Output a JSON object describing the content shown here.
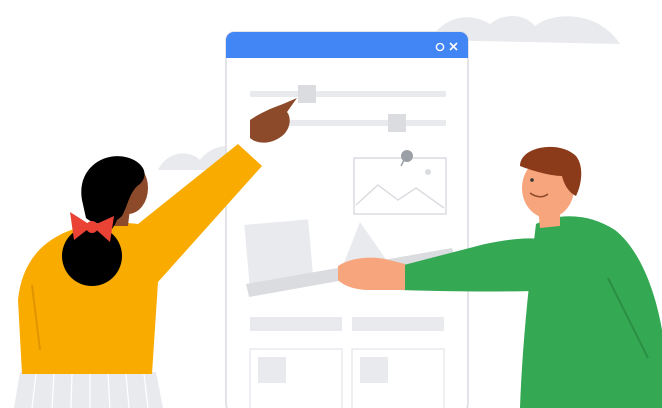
{
  "illustration": {
    "window": {
      "title_bar_color": "#4285F4",
      "controls": [
        {
          "icon": "circle-icon"
        },
        {
          "icon": "close-icon"
        }
      ]
    },
    "sliders": [
      {
        "value": 0.2
      },
      {
        "value": 0.75
      }
    ],
    "colors": {
      "mustard_shirt": "#F9AB00",
      "green_shirt": "#34A853",
      "placeholder_gray": "#DADCE0",
      "skin_dark": "#8D4A2A",
      "skin_light": "#F6A57C",
      "hair_brown": "#8B3A1A",
      "bow_red": "#EA4335",
      "cloud_gray": "#E8EAED"
    }
  }
}
